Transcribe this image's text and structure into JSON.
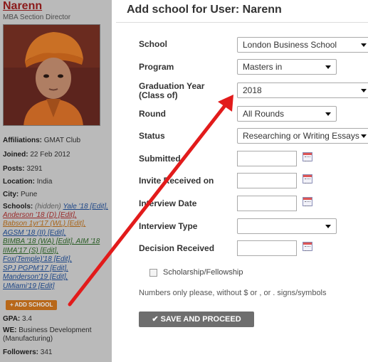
{
  "profile": {
    "username": "Narenn",
    "title": "MBA Section Director",
    "affiliations_label": "Affiliations:",
    "affiliations_value": "GMAT Club",
    "joined_label": "Joined:",
    "joined_value": "22 Feb 2012",
    "posts_label": "Posts:",
    "posts_value": "3291",
    "location_label": "Location:",
    "location_value": "India",
    "city_label": "City:",
    "city_value": "Pune",
    "schools_label": "Schools:",
    "schools_hidden": "(hidden)",
    "school_lines": [
      "Yale '18 [Edit],",
      "Anderson '18 (D) [Edit],",
      "Babson 1yr'17 (WL) [Edit],",
      "AGSM '18 (II) [Edit],",
      "BIMBA '18 (WA) [Edit], AIM '18",
      "IIMA'17 (S) [Edit],",
      "Fox(Temple)'18 [Edit],",
      "SPJ PGPM'17 [Edit],",
      "Manderson'19 [Edit],",
      "UMiami'19 [Edit]"
    ],
    "add_school_label": "+ ADD SCHOOL",
    "gpa_label": "GPA:",
    "gpa_value": "3.4",
    "we_label": "WE:",
    "we_value": "Business Development (Manufacturing)",
    "followers_label": "Followers:",
    "followers_value": "341"
  },
  "form": {
    "title": "Add school for User: Narenn",
    "school_label": "School",
    "school_value": "London Business School",
    "program_label": "Program",
    "program_value": "Masters in",
    "grad_year_label_1": "Graduation Year",
    "grad_year_label_2": "(Class of)",
    "grad_year_value": "2018",
    "round_label": "Round",
    "round_value": "All Rounds",
    "status_label": "Status",
    "status_value": "Researching or Writing Essays",
    "submitted_label": "Submitted",
    "invite_label": "Invite Received on",
    "interview_date_label": "Interview Date",
    "interview_type_label": "Interview Type",
    "interview_type_value": "",
    "decision_label": "Decision Received",
    "scholarship_label": "Scholarship/Fellowship",
    "note": "Numbers only please, without $ or , or . signs/symbols",
    "save_label": "✔ SAVE AND PROCEED"
  },
  "colors": {
    "arrow": "#e21b1b",
    "username": "#a02020",
    "add_school_bg": "#d4781e",
    "save_bg": "#6e6e6e"
  }
}
